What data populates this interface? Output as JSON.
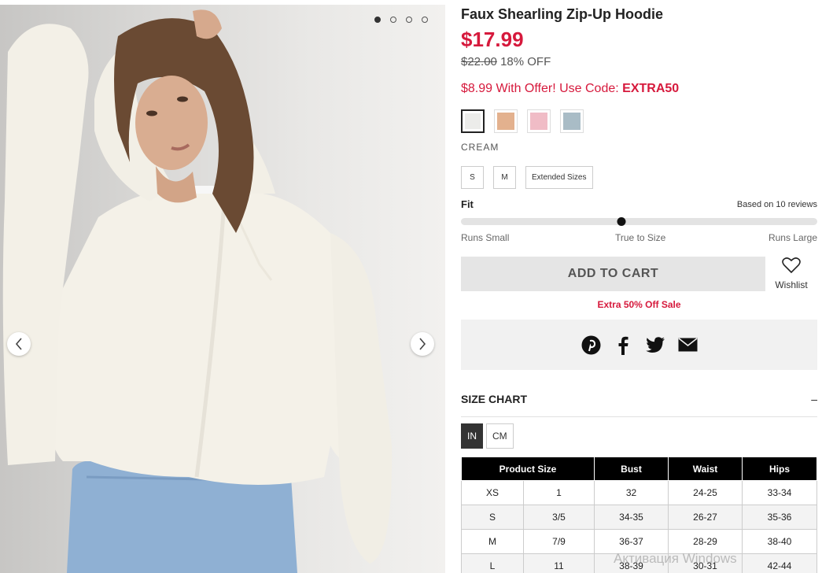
{
  "product": {
    "title": "Faux Shearling Zip-Up Hoodie",
    "price": "$17.99",
    "original_price": "$22.00",
    "discount": "18% OFF",
    "offer_text": "$8.99 With Offer! Use Code: ",
    "offer_code": "EXTRA50"
  },
  "gallery": {
    "image": "model-wearing-cream-faux-shearling-hoodie",
    "dots": 4,
    "active_dot": 0,
    "prev_icon": "chevron-left-icon",
    "next_icon": "chevron-right-icon"
  },
  "colors": {
    "swatches": [
      {
        "name": "cream",
        "hex": "#ececea",
        "selected": true
      },
      {
        "name": "tan",
        "hex": "#e3b18e",
        "selected": false
      },
      {
        "name": "pink",
        "hex": "#f0bcc6",
        "selected": false
      },
      {
        "name": "blue",
        "hex": "#a9bcc6",
        "selected": false
      }
    ],
    "selected_label": "CREAM"
  },
  "sizes": [
    "S",
    "M",
    "Extended Sizes"
  ],
  "fit": {
    "label": "Fit",
    "reviews": "Based on 10 reviews",
    "scale": [
      "Runs Small",
      "True to Size",
      "Runs Large"
    ],
    "value": 0.45
  },
  "actions": {
    "add_to_cart": "ADD TO CART",
    "wishlist": "Wishlist",
    "sale_note": "Extra 50% Off Sale"
  },
  "share": {
    "icons": [
      "pinterest-icon",
      "facebook-icon",
      "twitter-icon",
      "email-icon"
    ]
  },
  "size_chart": {
    "title": "SIZE CHART",
    "toggle": "–",
    "units": [
      "IN",
      "CM"
    ],
    "active_unit": "IN",
    "headers": [
      "Product Size",
      "",
      "Bust",
      "Waist",
      "Hips"
    ],
    "rows": [
      [
        "XS",
        "1",
        "32",
        "24-25",
        "33-34"
      ],
      [
        "S",
        "3/5",
        "34-35",
        "26-27",
        "35-36"
      ],
      [
        "M",
        "7/9",
        "36-37",
        "28-29",
        "38-40"
      ],
      [
        "L",
        "11",
        "38-39",
        "30-31",
        "42-44"
      ]
    ]
  },
  "watermark": "Активация Windows",
  "colors_theme": {
    "accent": "#d6193c",
    "dark": "#000000"
  }
}
